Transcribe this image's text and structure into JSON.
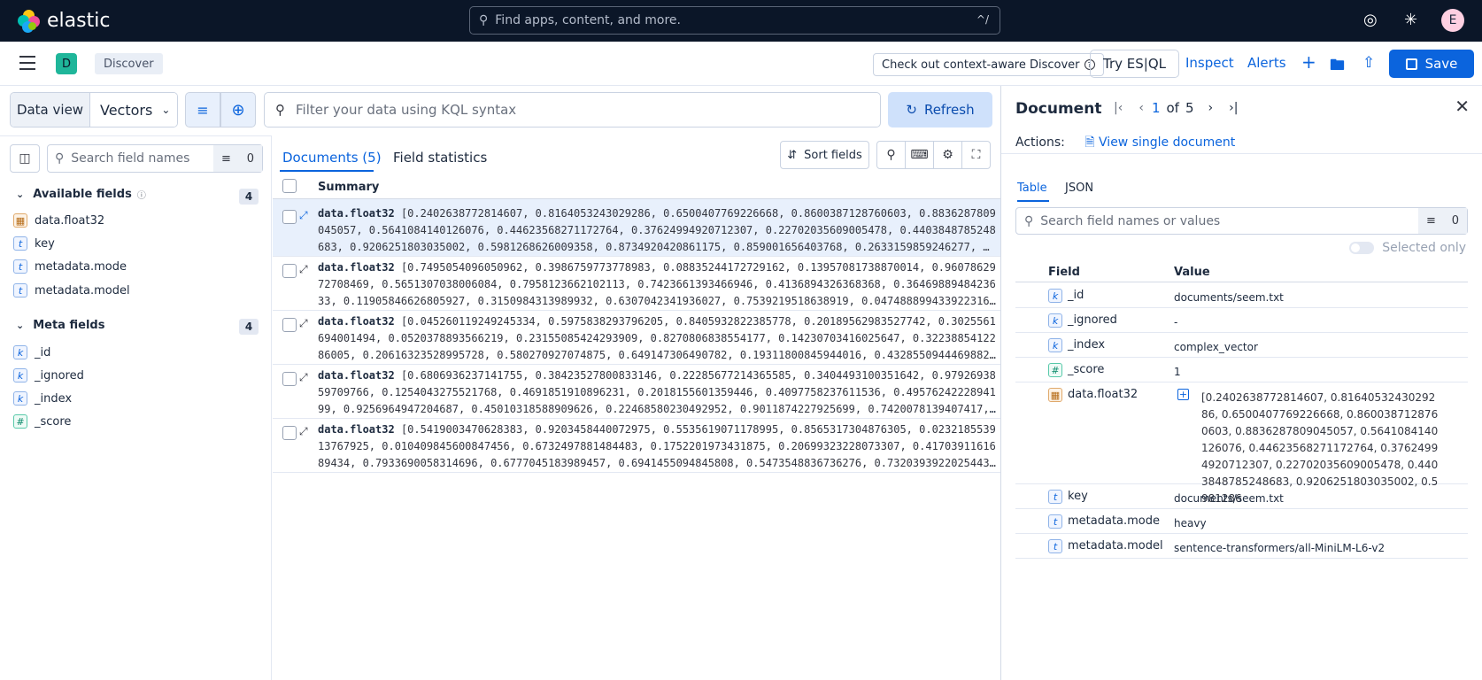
{
  "app": {
    "brand": "elastic",
    "search_placeholder": "Find apps, content, and more.",
    "search_shortcut": "^/",
    "avatar": "E"
  },
  "header": {
    "space_badge": "D",
    "breadcrumb": "Discover",
    "context_button": "Check out context-aware Discover",
    "esql_button": "Try ES|QL",
    "inspect": "Inspect",
    "alerts": "Alerts",
    "save": "Save"
  },
  "query": {
    "data_view_label": "Data view",
    "data_view_value": "Vectors",
    "kql_placeholder": "Filter your data using KQL syntax",
    "refresh": "Refresh"
  },
  "sidebar": {
    "search_placeholder": "Search field names",
    "filter_count": "0",
    "available": {
      "label": "Available fields",
      "count": "4",
      "fields": [
        {
          "name": "data.float32",
          "type": "vector"
        },
        {
          "name": "key",
          "type": "t"
        },
        {
          "name": "metadata.mode",
          "type": "t"
        },
        {
          "name": "metadata.model",
          "type": "t"
        }
      ]
    },
    "meta": {
      "label": "Meta fields",
      "count": "4",
      "fields": [
        {
          "name": "_id",
          "type": "k"
        },
        {
          "name": "_ignored",
          "type": "k"
        },
        {
          "name": "_index",
          "type": "k"
        },
        {
          "name": "_score",
          "type": "#"
        }
      ]
    }
  },
  "documents": {
    "tab_documents": "Documents (5)",
    "tab_stats": "Field statistics",
    "sort_fields": "Sort fields",
    "column_summary": "Summary",
    "rows": [
      {
        "field": "data.float32",
        "value": "[0.2402638772814607, 0.8164053243029286, 0.6500407769226668, 0.8600387128760603, 0.8836287809045057, 0.5641084140126076, 0.44623568271172764, 0.37624994920712307, 0.22702035609005478, 0.4403848785248683, 0.9206251803035002, 0.5981268626009358, 0.8734920420861175, 0.859001656403768, 0.2633159859246277, …"
      },
      {
        "field": "data.float32",
        "value": "[0.7495054096050962, 0.3986759773778983, 0.08835244172729162, 0.13957081738870014, 0.9607862972708469, 0.5651307038006084, 0.7958123662102113, 0.7423661393466946, 0.4136894326368368, 0.3646988948423633, 0.11905846626805927, 0.3150984313989932, 0.6307042341936027, 0.7539219518638919, 0.047488899433922316…"
      },
      {
        "field": "data.float32",
        "value": "[0.04526011924924533​4, 0.5975838293796205, 0.8405932822385778, 0.20189562983527742, 0.3025561694001494, 0.0520378893566219, 0.23155085424293909, 0.8270806838554177, 0.14230703416025647, 0.3223885412286005, 0.20616323528995728, 0.580270927074875, 0.649147306490782, 0.19311800845944016, 0.4328550944469882…"
      },
      {
        "field": "data.float32",
        "value": "[0.6806936237141755, 0.38423527800833146, 0.22285677214365585, 0.3404493100351642, 0.9792693859709766, 0.1254043275521768, 0.4691851910896231, 0.2018155601359446, 0.4097758237611536, 0.4957624222894199, 0.9256964947204687, 0.45010318588909626, 0.22468580230492952, 0.9011874227925699, 0.7420078139407417, …"
      },
      {
        "field": "data.float32",
        "value": "[0.5419003470628383, 0.9203458440072975, 0.5535619071178995, 0.8565317304876305, 0.023218553913767925, 0.010409845600847456, 0.6732497881484483, 0.1752201973431875, 0.20699323228073307, 0.4170391161689434, 0.7933690058314696, 0.6777045183989457, 0.6941455094845808, 0.5473548836736276, 0.7320393922025443…"
      }
    ]
  },
  "flyout": {
    "title": "Document",
    "page_current": "1",
    "page_of": "of",
    "page_total": "5",
    "actions_label": "Actions:",
    "view_single": "View single document",
    "tab_table": "Table",
    "tab_json": "JSON",
    "search_placeholder": "Search field names or values",
    "filter_count": "0",
    "selected_only": "Selected only",
    "col_field": "Field",
    "col_value": "Value",
    "fields": [
      {
        "type": "k",
        "name": "_id",
        "value": "documents/seem.txt"
      },
      {
        "type": "k",
        "name": "_ignored",
        "value": "-"
      },
      {
        "type": "k",
        "name": "_index",
        "value": "complex_vector"
      },
      {
        "type": "#",
        "name": "_score",
        "value": "1"
      },
      {
        "type": "vector",
        "name": "data.float32",
        "value": "[0.2402638772814607, 0.8164053243029286, 0.6500407769226668, 0.8600387128760603, 0.8836287809045057, 0.5641084140126076, 0.44623568271172764, 0.37624994920712307, 0.22702035609005478, 0.4403848785248683, 0.9206251803035002, 0.5981286"
      },
      {
        "type": "t",
        "name": "key",
        "value": "documents/seem.txt"
      },
      {
        "type": "t",
        "name": "metadata.mode",
        "value": "heavy"
      },
      {
        "type": "t",
        "name": "metadata.model",
        "value": "sentence-transformers/all-MiniLM-L6-v2"
      }
    ]
  }
}
